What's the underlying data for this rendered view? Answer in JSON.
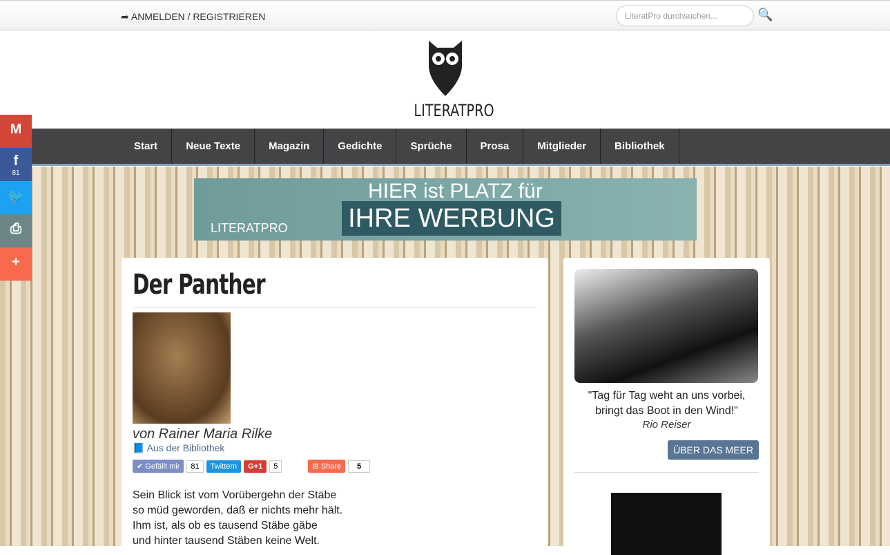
{
  "topbar": {
    "login": "ANMELDEN / REGISTRIEREN",
    "search_placeholder": "LiteratPro durchsuchen..."
  },
  "logo": {
    "text": "LITERATPRO"
  },
  "nav": [
    "Start",
    "Neue Texte",
    "Magazin",
    "Gedichte",
    "Sprüche",
    "Prosa",
    "Mitglieder",
    "Bibliothek"
  ],
  "social": {
    "facebook_count": "81",
    "colors": {
      "gmail": "#d44638",
      "facebook": "#3b5998",
      "twitter": "#1da1f2",
      "print": "#6d8687",
      "more": "#f8694d"
    }
  },
  "ad": {
    "line1": "HIER ist PLATZ für",
    "line2": "IHRE WERBUNG",
    "logo": "LITERATPRO"
  },
  "article": {
    "title": "Der Panther",
    "author": "von Rainer Maria Rilke",
    "source": "Aus der Bibliothek",
    "share": {
      "like": "Gefällt mir",
      "like_count": "81",
      "twitter": "Twittern",
      "gplus": "G+1",
      "gplus_count": "5",
      "share": "Share",
      "share_count": "5"
    },
    "poem": [
      "Sein Blick ist vom Vorübergehn der Stäbe",
      "so müd geworden, daß er nichts mehr hält.",
      "Ihm ist, als ob es tausend Stäbe gäbe",
      "und hinter tausend Stäben keine Welt."
    ]
  },
  "sidebar": {
    "quote": "\"Tag für Tag weht an uns vorbei, bringt das Boot in den Wind!\"",
    "quote_author": "Rio Reiser",
    "button": "ÜBER DAS MEER"
  }
}
